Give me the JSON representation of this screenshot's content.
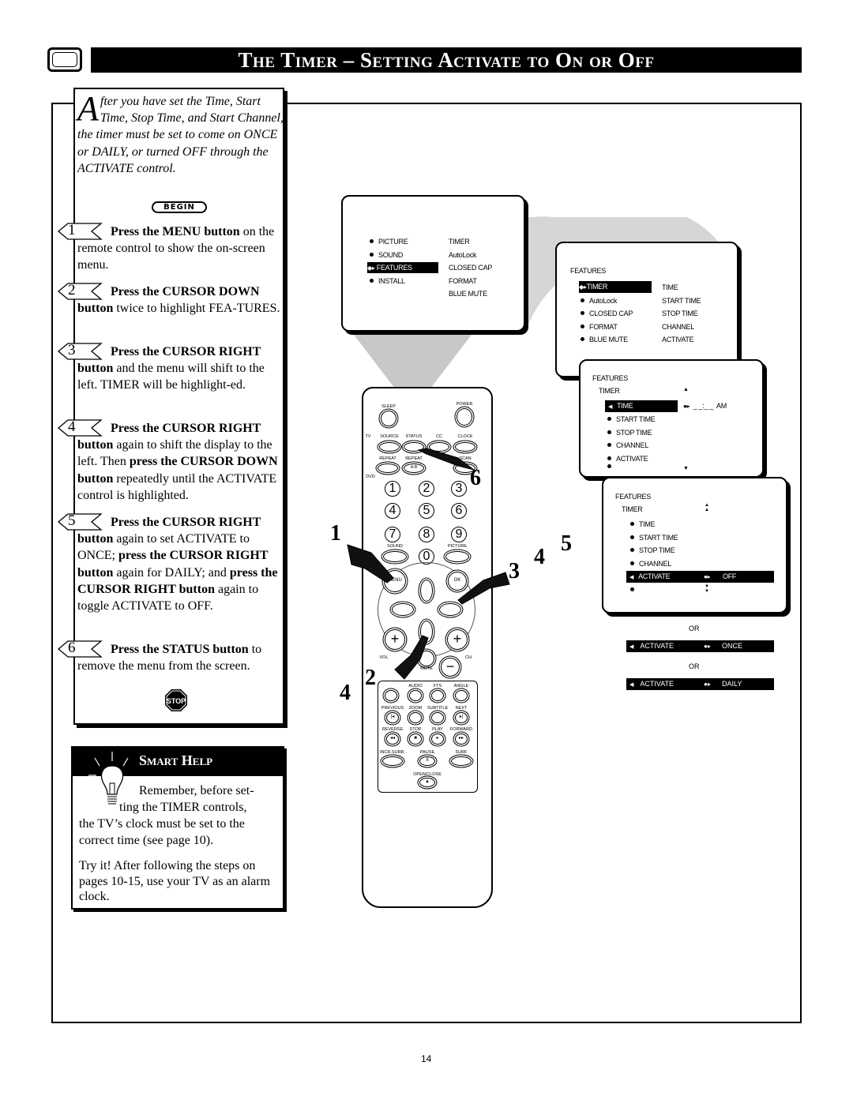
{
  "header": {
    "title": "The Timer – Setting Activate to On or Off",
    "icon": "tv-icon"
  },
  "intro": {
    "dropcap": "A",
    "text": "fter you have set the Time, Start Time, Stop Time, and Start Channel, the timer must be set to come on ONCE or DAILY,  or turned OFF through the ACTIVATE control.",
    "begin": "BEGIN"
  },
  "steps": [
    {
      "n": "1",
      "segs": [
        {
          "t": "Press the MENU button",
          "b": true
        },
        {
          "t": " on the remote control to show the on-screen menu."
        }
      ]
    },
    {
      "n": "2",
      "segs": [
        {
          "t": "Press the CURSOR DOWN button",
          "b": true
        },
        {
          "t": " twice to highlight FEA-TURES."
        }
      ]
    },
    {
      "n": "3",
      "segs": [
        {
          "t": "Press the CURSOR RIGHT button",
          "b": true
        },
        {
          "t": " and the menu will shift to the left. TIMER will be highlight-ed."
        }
      ]
    },
    {
      "n": "4",
      "segs": [
        {
          "t": "Press the CURSOR RIGHT button",
          "b": true
        },
        {
          "t": " again to shift the display to the left. Then "
        },
        {
          "t": "press the CURSOR DOWN button",
          "b": true
        },
        {
          "t": " repeatedly until the ACTIVATE control is highlighted."
        }
      ]
    },
    {
      "n": "5",
      "segs": [
        {
          "t": "Press the CURSOR RIGHT button",
          "b": true
        },
        {
          "t": " again to set ACTIVATE to ONCE; "
        },
        {
          "t": "press the CURSOR RIGHT button",
          "b": true
        },
        {
          "t": " again for DAILY; and "
        },
        {
          "t": "press the CURSOR RIGHT button",
          "b": true
        },
        {
          "t": " again to toggle ACTIVATE to OFF."
        }
      ]
    },
    {
      "n": "6",
      "segs": [
        {
          "t": "Press the STATUS button",
          "b": true
        },
        {
          "t": " to remove the menu from the screen."
        }
      ]
    }
  ],
  "stop_icon": "STOP",
  "smart_help": {
    "title": "Smart Help",
    "p1": "Remember, before set-ting the TIMER controls, the TV’s clock must be set to the correct time (see page 10).",
    "p1a": "Remember, before set-",
    "p1b": "ting the TIMER controls,",
    "p1c": "the TV’s clock must be set to the correct time (see page 10).",
    "p2": "Try it! After following the steps on pages 10-15, use your TV as an alarm clock.",
    "icon": "lightbulb-icon"
  },
  "menu1": {
    "left": [
      "PICTURE",
      "SOUND",
      "FEATURES",
      "INSTALL"
    ],
    "right": [
      "TIMER",
      "AutoLock",
      "CLOSED CAP",
      "FORMAT",
      "BLUE MUTE"
    ]
  },
  "menu2": {
    "title": "FEATURES",
    "left": [
      "TIMER",
      "AutoLock",
      "CLOSED CAP",
      "FORMAT",
      "BLUE MUTE"
    ],
    "right": [
      "TIME",
      "START TIME",
      "STOP TIME",
      "CHANNEL",
      "ACTIVATE"
    ]
  },
  "menu3": {
    "title": "FEATURES",
    "sub": "TIMER",
    "items": [
      "TIME",
      "START TIME",
      "STOP TIME",
      "CHANNEL",
      "ACTIVATE"
    ],
    "value": "_ _:_ _",
    "ampm": "AM"
  },
  "menu4": {
    "title": "FEATURES",
    "sub": "TIMER",
    "items": [
      "TIME",
      "START TIME",
      "STOP TIME",
      "CHANNEL",
      "ACTIVATE"
    ],
    "value": "OFF"
  },
  "alternatives": {
    "or": "OR",
    "label": "ACTIVATE",
    "once": "ONCE",
    "daily": "DAILY"
  },
  "remote": {
    "sleep": "SLEEP",
    "power": "POWER",
    "tv": "TV",
    "dvd": "DVD",
    "row1": [
      "SOURCE",
      "STATUS",
      "CC",
      "CLOCK"
    ],
    "row2": [
      "REPEAT",
      "REPEAT",
      "SCAN"
    ],
    "ab": "A-B",
    "digits": [
      "1",
      "2",
      "3",
      "4",
      "5",
      "6",
      "7",
      "8",
      "9",
      "0"
    ],
    "sound": "SOUND",
    "picture": "PICTURE",
    "menu": "MENU",
    "ok": "OK",
    "vol": "VOL",
    "ch": "CH",
    "mute": "MUTE",
    "plus": "+",
    "minus": "−",
    "dvd1": [
      "AUDIO",
      "FTS",
      "ANGLE"
    ],
    "dvd2": [
      "PREVIOUS",
      "ZOOM",
      "SUBTITLE",
      "NEXT"
    ],
    "dvd3": [
      "REVERSE",
      "STOP",
      "PLAY",
      "FORWARD"
    ],
    "dvd4": [
      "INCR.SURR.",
      "PAUSE",
      "SURF"
    ],
    "open_close": "OPEN/CLOSE"
  },
  "callouts": [
    "1",
    "2",
    "4",
    "3",
    "4",
    "5",
    "6"
  ],
  "page_number": "14"
}
